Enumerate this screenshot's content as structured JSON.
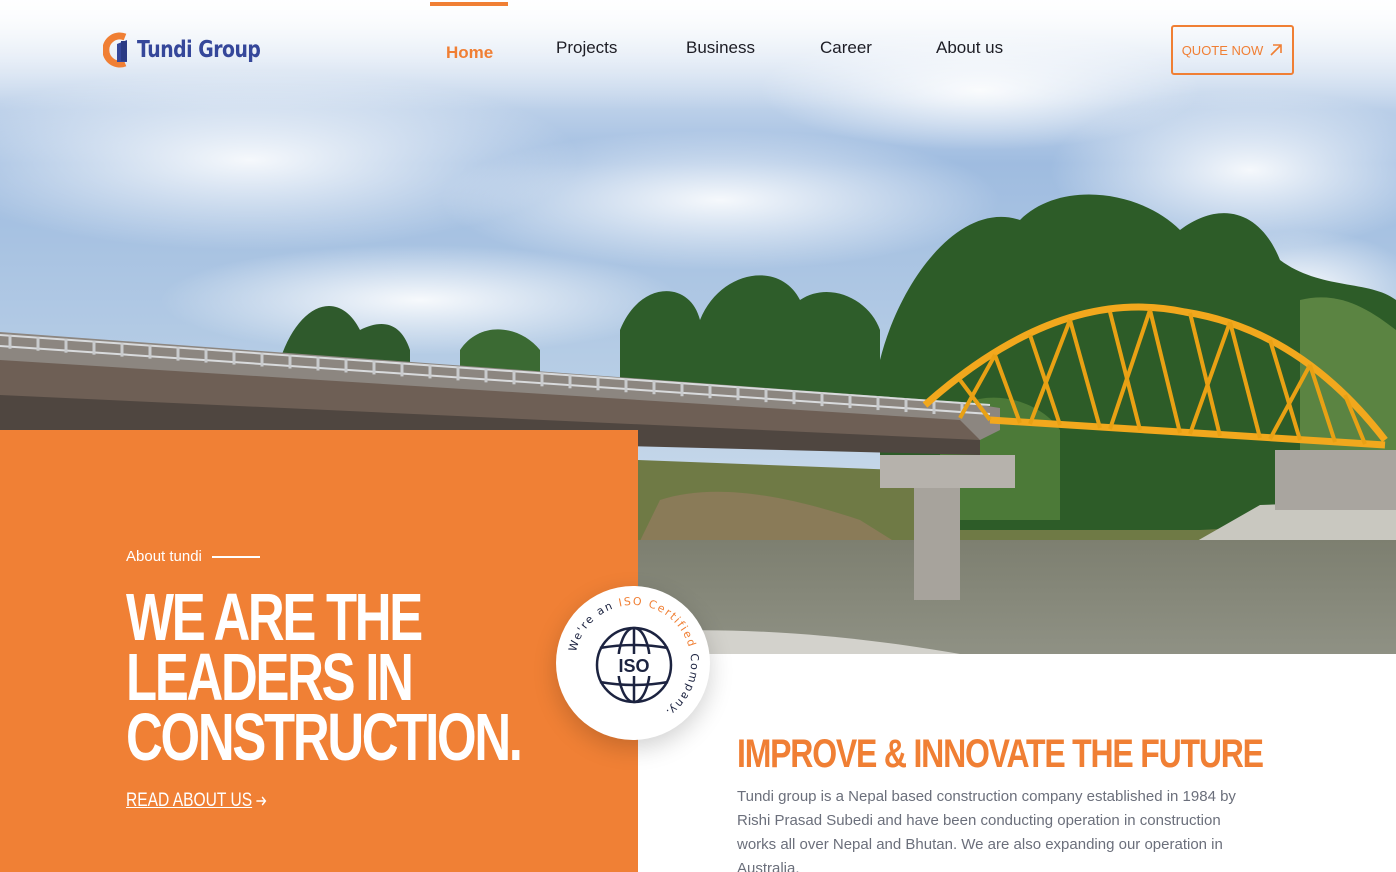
{
  "brand": {
    "name": "Tundi Group",
    "logo_colors": {
      "orange": "#f07f34",
      "blue": "#35479a"
    }
  },
  "nav": {
    "items": [
      {
        "label": "Home",
        "active": true
      },
      {
        "label": "Projects",
        "active": false
      },
      {
        "label": "Business",
        "active": false
      },
      {
        "label": "Career",
        "active": false
      },
      {
        "label": "About us",
        "active": false
      }
    ],
    "cta_label": "QUOTE NOW",
    "cta_icon": "arrow-up-right-icon"
  },
  "hero": {
    "image": "bridge-over-river-photo",
    "panel": {
      "eyebrow": "About tundi",
      "headline_lines": [
        "WE ARE THE",
        "LEADERS IN",
        "CONSTRUCTION."
      ],
      "link_label": "READ ABOUT US",
      "link_icon": "arrow-right-icon"
    }
  },
  "iso_badge": {
    "center_label": "ISO",
    "ring_prefix": "We're an ",
    "ring_highlight": "ISO Certified",
    "ring_suffix": " Company.",
    "icon": "globe-icon"
  },
  "about": {
    "title": "IMPROVE & INNOVATE THE FUTURE",
    "body": "Tundi group is a Nepal based construction company established in 1984 by Rishi Prasad Subedi and have been conducting operation in construction works all over Nepal and Bhutan. We are also expanding our operation in Australia."
  },
  "colors": {
    "accent": "#f07f34",
    "panel": "#f08035",
    "nav_text": "#1d1d25",
    "body_text": "#6b6f7b",
    "bridge_steel": "#f2a81d"
  }
}
